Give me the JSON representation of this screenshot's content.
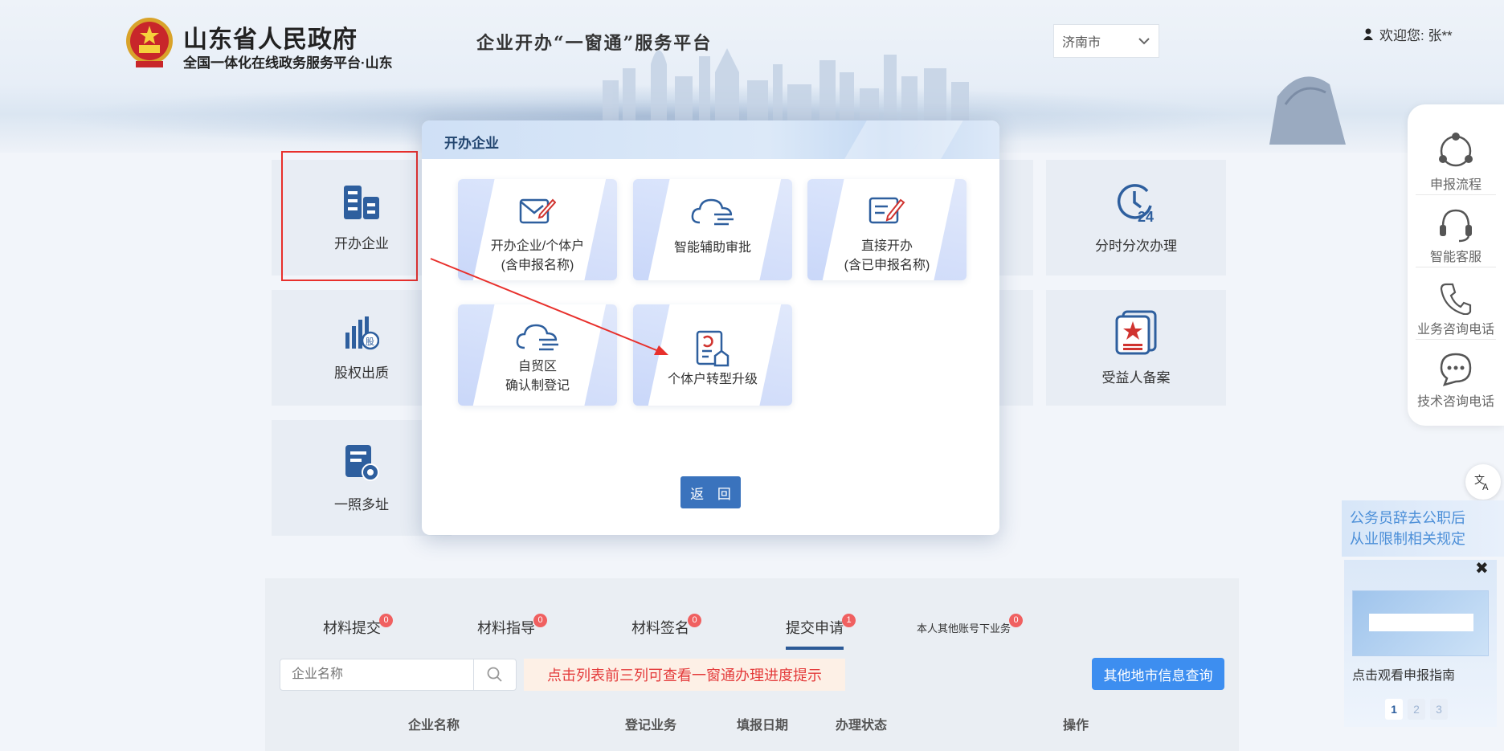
{
  "header": {
    "gov_title": "山东省人民政府",
    "gov_subtitle": "全国一体化在线政务服务平台·山东",
    "platform_title": "企业开办“一窗通”服务平台",
    "city_selected": "济南市",
    "welcome_text": "欢迎您:  张**"
  },
  "tiles": [
    {
      "label": "开办企业",
      "icon": "building-icon"
    },
    {
      "label": "分时分次办理",
      "icon": "clock-24-icon"
    },
    {
      "label": "股权出质",
      "icon": "equity-chart-icon"
    },
    {
      "label": "受益人备案",
      "icon": "star-document-icon"
    },
    {
      "label": "一照多址",
      "icon": "license-gear-icon"
    }
  ],
  "modal": {
    "title": "开办企业",
    "cards": [
      {
        "line1": "开办企业/个体户",
        "line2": "(含申报名称)",
        "icon": "edit-envelope-icon"
      },
      {
        "line1": "智能辅助审批",
        "line2": "",
        "icon": "cloud-icon"
      },
      {
        "line1": "直接开办",
        "line2": "(含已申报名称)",
        "icon": "edit-form-icon"
      },
      {
        "line1": "自贸区",
        "line2": "确认制登记",
        "icon": "cloud-icon"
      },
      {
        "line1": "个体户转型升级",
        "line2": "",
        "icon": "upgrade-document-icon"
      }
    ],
    "back_label": "返 回"
  },
  "tabs": [
    {
      "label": "材料提交",
      "badge": "0"
    },
    {
      "label": "材料指导",
      "badge": "0"
    },
    {
      "label": "材料签名",
      "badge": "0"
    },
    {
      "label": "提交申请",
      "badge": "1"
    },
    {
      "label": "本人其他账号下业务",
      "badge": "0"
    }
  ],
  "search": {
    "placeholder": "企业名称"
  },
  "notice_text": "点击列表前三列可查看一窗通办理进度提示",
  "other_query_label": "其他地市信息查询",
  "table_columns": [
    "企业名称",
    "登记业务",
    "填报日期",
    "办理状态",
    "操作"
  ],
  "sidebar": [
    {
      "label": "申报流程",
      "icon": "process-icon"
    },
    {
      "label": "智能客服",
      "icon": "headset-icon"
    },
    {
      "label": "业务咨询电话",
      "icon": "phone-icon"
    },
    {
      "label": "技术咨询电话",
      "icon": "chat-icon"
    }
  ],
  "news": {
    "line1": "公务员辞去公职后",
    "line2": "从业限制相关规定"
  },
  "video": {
    "label": "点击观看申报指南",
    "close": "✖"
  },
  "pager": [
    "1",
    "2",
    "3"
  ],
  "colors": {
    "accent": "#3a73bd",
    "highlight": "#e8302c",
    "icon_blue": "#2e5f9e",
    "badge": "#f06060"
  }
}
